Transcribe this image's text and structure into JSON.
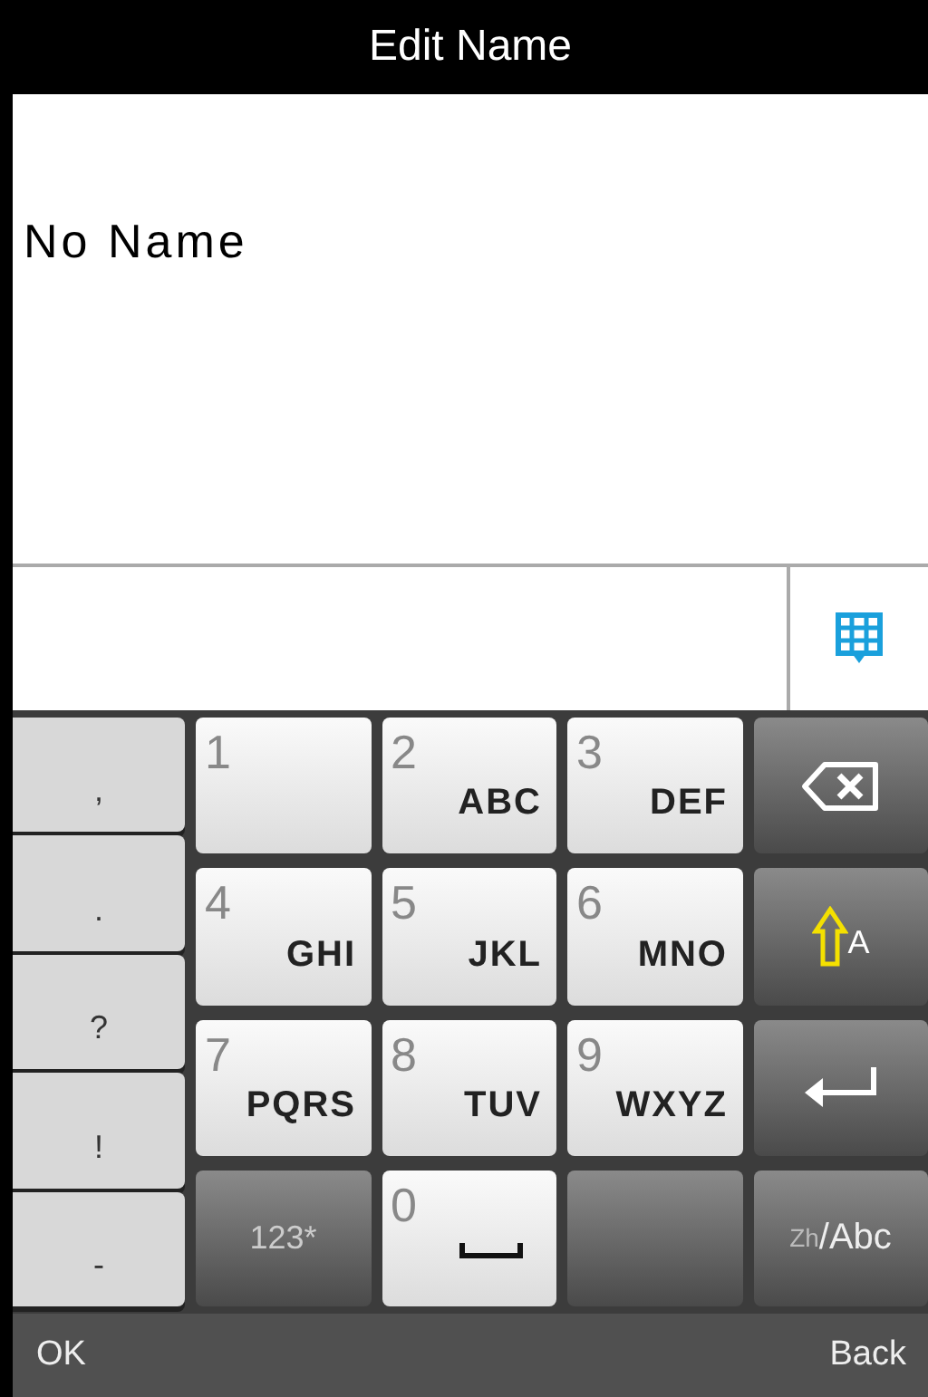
{
  "title": "Edit Name",
  "name_text": "No Name",
  "punctuation_keys": [
    ",",
    ".",
    "?",
    "!",
    "-"
  ],
  "keys": [
    {
      "kind": "digit",
      "digit": "1"
    },
    {
      "kind": "digit",
      "digit": "2",
      "letters": "ABC"
    },
    {
      "kind": "digit",
      "digit": "3",
      "letters": "DEF"
    },
    {
      "kind": "backspace"
    },
    {
      "kind": "digit",
      "digit": "4",
      "letters": "GHI"
    },
    {
      "kind": "digit",
      "digit": "5",
      "letters": "JKL"
    },
    {
      "kind": "digit",
      "digit": "6",
      "letters": "MNO"
    },
    {
      "kind": "shift",
      "label": "A"
    },
    {
      "kind": "digit",
      "digit": "7",
      "letters": "PQRS"
    },
    {
      "kind": "digit",
      "digit": "8",
      "letters": "TUV"
    },
    {
      "kind": "digit",
      "digit": "9",
      "letters": "WXYZ"
    },
    {
      "kind": "enter"
    },
    {
      "kind": "symbols",
      "label": "123*"
    },
    {
      "kind": "space",
      "digit": "0"
    },
    {
      "kind": "blank"
    },
    {
      "kind": "lang",
      "small": "Zh",
      "label": "/Abc"
    }
  ],
  "softkeys": {
    "left": "OK",
    "right": "Back"
  }
}
